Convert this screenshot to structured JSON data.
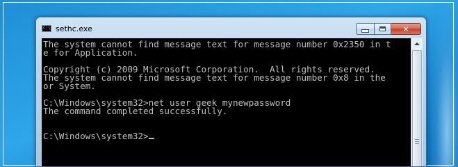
{
  "window": {
    "title": "sethc.exe",
    "icon": "cmd-icon",
    "icon_text": "C:\\",
    "controls": {
      "minimize": "minimize-icon",
      "maximize": "maximize-icon",
      "close": "close-icon",
      "close_glyph": "✕"
    }
  },
  "console": {
    "lines": [
      "The system cannot find message text for message number 0x2350 in t",
      "e for Application.",
      "",
      "Copyright (c) 2009 Microsoft Corporation.  All rights reserved.",
      "The system cannot find message text for message number 0x8 in the",
      "or System.",
      "",
      "C:\\Windows\\system32>net user geek mynewpassword",
      "The command completed successfully.",
      "",
      "",
      "C:\\Windows\\system32>"
    ],
    "text_color": "#c0c0c0",
    "background_color": "#000000"
  },
  "colors": {
    "desktop": "#2fa6ea",
    "window_frame": "#b9d3ea",
    "close_button": "#c14127"
  }
}
